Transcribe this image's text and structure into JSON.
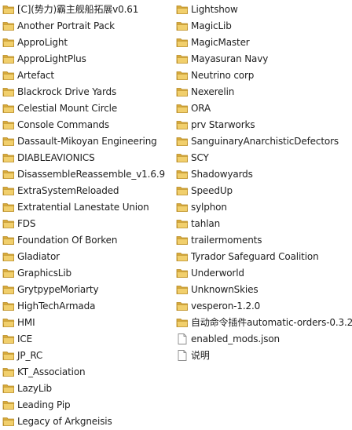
{
  "colors": {
    "folder_back": "#d7a93b",
    "folder_front": "#f1cf6c",
    "folder_edge": "#b88a22",
    "file_page": "#ffffff",
    "file_edge": "#8a8a8a",
    "text": "#1e1e1e"
  },
  "columns": [
    {
      "items": [
        {
          "name": "[C](势力)霸主舰船拓展v0.61",
          "type": "folder",
          "icon": "folder-icon"
        },
        {
          "name": "Another Portrait Pack",
          "type": "folder",
          "icon": "folder-icon"
        },
        {
          "name": "ApproLight",
          "type": "folder",
          "icon": "folder-icon"
        },
        {
          "name": "ApproLightPlus",
          "type": "folder",
          "icon": "folder-icon"
        },
        {
          "name": "Artefact",
          "type": "folder",
          "icon": "folder-icon"
        },
        {
          "name": "Blackrock Drive Yards",
          "type": "folder",
          "icon": "folder-icon"
        },
        {
          "name": "Celestial Mount Circle",
          "type": "folder",
          "icon": "folder-icon"
        },
        {
          "name": "Console Commands",
          "type": "folder",
          "icon": "folder-icon"
        },
        {
          "name": "Dassault-Mikoyan Engineering",
          "type": "folder",
          "icon": "folder-icon"
        },
        {
          "name": "DIABLEAVIONICS",
          "type": "folder",
          "icon": "folder-icon"
        },
        {
          "name": "DisassembleReassemble_v1.6.9",
          "type": "folder",
          "icon": "folder-icon"
        },
        {
          "name": "ExtraSystemReloaded",
          "type": "folder",
          "icon": "folder-icon"
        },
        {
          "name": "Extratential Lanestate Union",
          "type": "folder",
          "icon": "folder-icon"
        },
        {
          "name": "FDS",
          "type": "folder",
          "icon": "folder-icon"
        },
        {
          "name": "Foundation Of Borken",
          "type": "folder",
          "icon": "folder-icon"
        },
        {
          "name": "Gladiator",
          "type": "folder",
          "icon": "folder-icon"
        },
        {
          "name": "GraphicsLib",
          "type": "folder",
          "icon": "folder-icon"
        },
        {
          "name": "GrytpypeMoriarty",
          "type": "folder",
          "icon": "folder-icon"
        },
        {
          "name": "HighTechArmada",
          "type": "folder",
          "icon": "folder-icon"
        },
        {
          "name": "HMI",
          "type": "folder",
          "icon": "folder-icon"
        },
        {
          "name": "ICE",
          "type": "folder",
          "icon": "folder-icon"
        },
        {
          "name": "JP_RC",
          "type": "folder",
          "icon": "folder-icon"
        },
        {
          "name": "KT_Association",
          "type": "folder",
          "icon": "folder-icon"
        },
        {
          "name": "LazyLib",
          "type": "folder",
          "icon": "folder-icon"
        },
        {
          "name": "Leading Pip",
          "type": "folder",
          "icon": "folder-icon"
        },
        {
          "name": "Legacy of Arkgneisis",
          "type": "folder",
          "icon": "folder-icon"
        }
      ]
    },
    {
      "items": [
        {
          "name": "Lightshow",
          "type": "folder",
          "icon": "folder-icon"
        },
        {
          "name": "MagicLib",
          "type": "folder",
          "icon": "folder-icon"
        },
        {
          "name": "MagicMaster",
          "type": "folder",
          "icon": "folder-icon"
        },
        {
          "name": "Mayasuran Navy",
          "type": "folder",
          "icon": "folder-icon"
        },
        {
          "name": "Neutrino corp",
          "type": "folder",
          "icon": "folder-icon"
        },
        {
          "name": "Nexerelin",
          "type": "folder",
          "icon": "folder-icon"
        },
        {
          "name": "ORA",
          "type": "folder",
          "icon": "folder-icon"
        },
        {
          "name": "prv Starworks",
          "type": "folder",
          "icon": "folder-icon"
        },
        {
          "name": "SanguinaryAnarchisticDefectors",
          "type": "folder",
          "icon": "folder-icon"
        },
        {
          "name": "SCY",
          "type": "folder",
          "icon": "folder-icon"
        },
        {
          "name": "Shadowyards",
          "type": "folder",
          "icon": "folder-icon"
        },
        {
          "name": "SpeedUp",
          "type": "folder",
          "icon": "folder-icon"
        },
        {
          "name": "sylphon",
          "type": "folder",
          "icon": "folder-icon"
        },
        {
          "name": "tahlan",
          "type": "folder",
          "icon": "folder-icon"
        },
        {
          "name": "trailermoments",
          "type": "folder",
          "icon": "folder-icon"
        },
        {
          "name": "Tyrador Safeguard Coalition",
          "type": "folder",
          "icon": "folder-icon"
        },
        {
          "name": "Underworld",
          "type": "folder",
          "icon": "folder-icon"
        },
        {
          "name": "UnknownSkies",
          "type": "folder",
          "icon": "folder-icon"
        },
        {
          "name": "vesperon-1.2.0",
          "type": "folder",
          "icon": "folder-icon"
        },
        {
          "name": "自动命令插件automatic-orders-0.3.2",
          "type": "folder",
          "icon": "folder-icon"
        },
        {
          "name": "enabled_mods.json",
          "type": "file",
          "icon": "json-file-icon"
        },
        {
          "name": "说明",
          "type": "file",
          "icon": "text-file-icon"
        }
      ]
    }
  ]
}
